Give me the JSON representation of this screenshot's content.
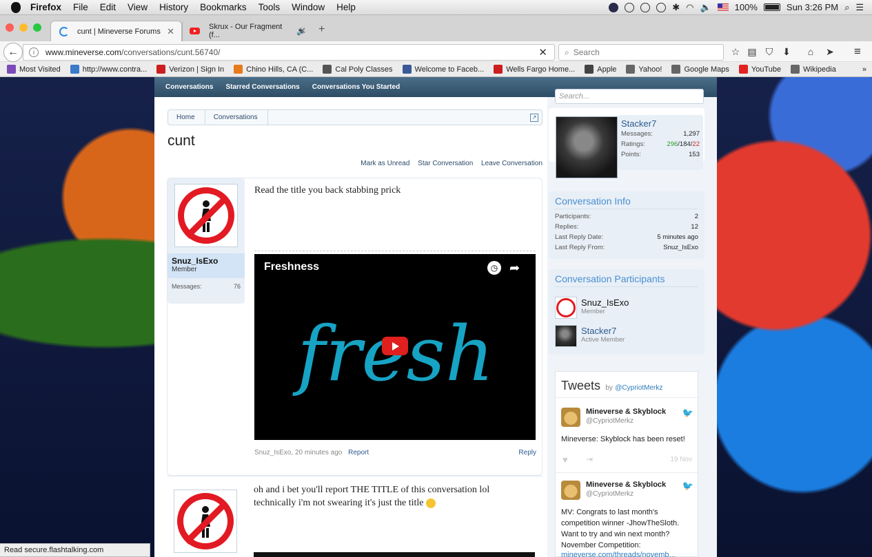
{
  "menubar": {
    "items": [
      "Firefox",
      "File",
      "Edit",
      "View",
      "History",
      "Bookmarks",
      "Tools",
      "Window",
      "Help"
    ],
    "battery": "100%",
    "clock": "Sun 3:26 PM"
  },
  "tabs": [
    {
      "title": "cunt | Mineverse Forums"
    },
    {
      "title": "Skrux - Our Fragment (f..."
    }
  ],
  "nav": {
    "url_host": "www.mineverse.com",
    "url_path": "/conversations/cunt.56740/",
    "search_placeholder": "Search"
  },
  "bookmarks": [
    {
      "label": "Most Visited",
      "color": "#7a4bb8"
    },
    {
      "label": "http://www.contra...",
      "color": "#3a7ac8"
    },
    {
      "label": "Verizon | Sign In",
      "color": "#cc1e1e"
    },
    {
      "label": "Chino Hills, CA (C...",
      "color": "#e87a1a"
    },
    {
      "label": "Cal Poly Classes",
      "color": "#555555"
    },
    {
      "label": "Welcome to Faceb...",
      "color": "#3b5998"
    },
    {
      "label": "Wells Fargo Home...",
      "color": "#cc1e1e"
    },
    {
      "label": "Apple",
      "color": "#444444"
    },
    {
      "label": "Yahoo!",
      "color": "#666666"
    },
    {
      "label": "Google Maps",
      "color": "#666666"
    },
    {
      "label": "YouTube",
      "color": "#e22222"
    },
    {
      "label": "Wikipedia",
      "color": "#666666"
    }
  ],
  "forum": {
    "nav": [
      "Conversations",
      "Starred Conversations",
      "Conversations You Started"
    ],
    "sidebar_search_placeholder": "Search...",
    "breadcrumb": [
      "Home",
      "Conversations"
    ],
    "title": "cunt",
    "actions": [
      "Mark as Unread",
      "Star Conversation",
      "Leave Conversation"
    ],
    "messages": [
      {
        "author": "Snuz_IsExo",
        "role": "Member",
        "stat_label": "Messages:",
        "stat_value": "76",
        "text": "Read the title you back stabbing prick",
        "video_title": "Freshness",
        "video_word": "fresh",
        "meta_author": "Snuz_IsExo",
        "meta_time": "20 minutes ago",
        "report": "Report",
        "reply": "Reply"
      },
      {
        "text": "oh and i bet you'll report THE TITLE of this conversation lol technically i'm not swearing it's just the title"
      }
    ],
    "visitor": {
      "name": "Stacker7",
      "messages_label": "Messages:",
      "messages": "1,297",
      "ratings_label": "Ratings:",
      "ratings_pos": "296",
      "ratings_mid": "/184/",
      "ratings_neg": "22",
      "points_label": "Points:",
      "points": "153"
    },
    "info": {
      "heading": "Conversation Info",
      "rows": [
        {
          "label": "Participants:",
          "value": "2"
        },
        {
          "label": "Replies:",
          "value": "12"
        },
        {
          "label": "Last Reply Date:",
          "value": "5 minutes ago"
        },
        {
          "label": "Last Reply From:",
          "value": "Snuz_IsExo"
        }
      ]
    },
    "participants": {
      "heading": "Conversation Participants",
      "list": [
        {
          "name": "Snuz_IsExo",
          "role": "Member"
        },
        {
          "name": "Stacker7",
          "role": "Active Member"
        }
      ]
    },
    "tweets": {
      "heading": "Tweets",
      "by": "by",
      "handle": "@CypriotMerkz",
      "items": [
        {
          "name": "Mineverse & Skyblock",
          "handle": "@CypriotMerkz",
          "text": "Mineverse: Skyblock has been reset!",
          "date": "19 Nov"
        },
        {
          "name": "Mineverse & Skyblock",
          "handle": "@CypriotMerkz",
          "text": "MV: Congrats to last month's competition winner -JhowTheSloth. Want to try and win next month? November Competition:",
          "link": "mineverse.com/threads/novemb..."
        }
      ]
    }
  },
  "status_text": "Read secure.flashtalking.com"
}
